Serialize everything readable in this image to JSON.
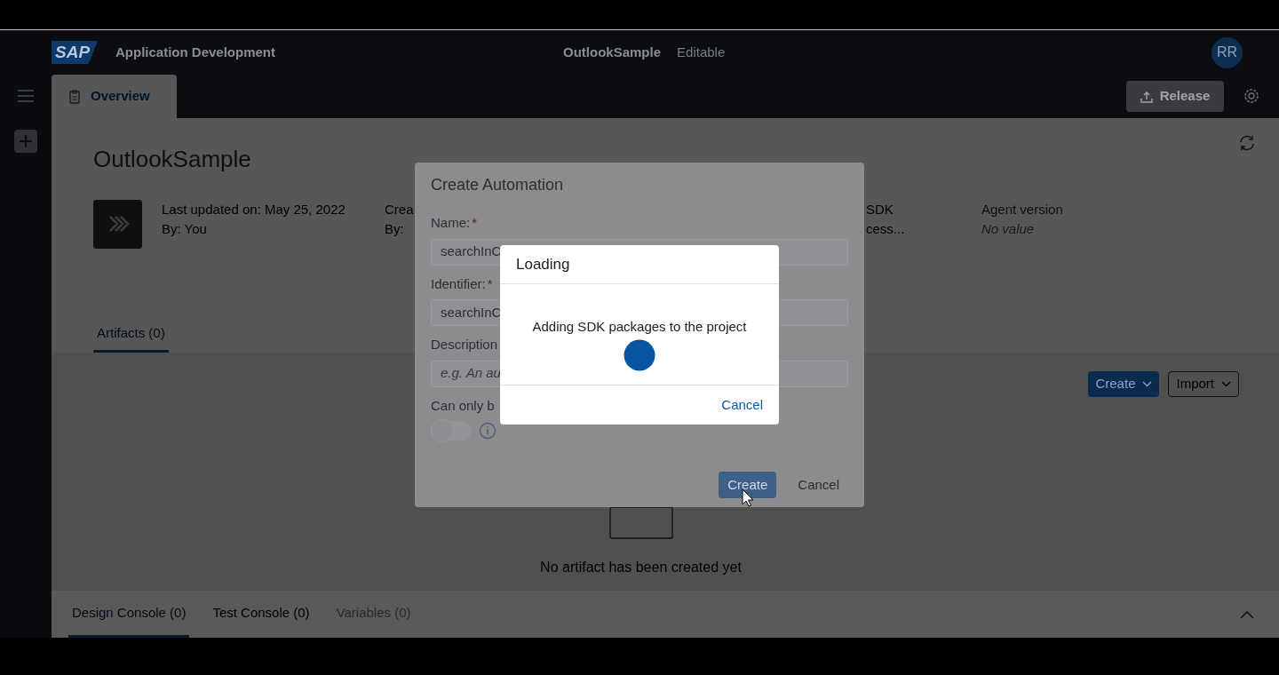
{
  "header": {
    "logo": "SAP",
    "app_title": "Application Development",
    "project_name": "OutlookSample",
    "project_state": "Editable",
    "avatar": "RR"
  },
  "tabs": [
    {
      "label": "Overview",
      "selected": true
    }
  ],
  "release_button": "Release",
  "page": {
    "title": "OutlookSample",
    "meta_columns": [
      {
        "lines": [
          {
            "text": "Last updated on: May 25, 2022",
            "kind": "value"
          },
          {
            "text": "By: You",
            "kind": "value"
          }
        ]
      },
      {
        "lines": [
          {
            "text": "Crea",
            "kind": "value"
          },
          {
            "text": "By:",
            "kind": "value"
          }
        ]
      },
      {
        "lines": [
          {
            "text": "SDK",
            "kind": "value"
          },
          {
            "text": "cess...",
            "kind": "value"
          }
        ]
      },
      {
        "lines": [
          {
            "text": "Agent version",
            "kind": "label"
          },
          {
            "text": "No value",
            "kind": "empty"
          }
        ]
      }
    ]
  },
  "section_tabs": [
    {
      "label": "Artifacts (0)",
      "selected": true
    }
  ],
  "artifact_buttons": [
    {
      "label": "Create",
      "kind": "primary"
    },
    {
      "label": "Import",
      "kind": "secondary"
    }
  ],
  "empty_state": "No artifact has been created yet",
  "console_tabs": [
    {
      "label": "Design Console (0)",
      "selected": true,
      "disabled": false
    },
    {
      "label": "Test Console (0)",
      "selected": false,
      "disabled": false
    },
    {
      "label": "Variables (0)",
      "selected": false,
      "disabled": true
    }
  ],
  "create_dialog": {
    "title": "Create Automation",
    "fields": [
      {
        "label": "Name:",
        "required_mark": "*",
        "value": "searchInC"
      },
      {
        "label": "Identifier:",
        "required_mark": "*",
        "value": "searchInC"
      },
      {
        "label": "Description",
        "placeholder": "e.g. An au"
      }
    ],
    "toggle": {
      "label": "Can only b",
      "on": false
    },
    "buttons": [
      {
        "label": "Create",
        "kind": "primary"
      },
      {
        "label": "Cancel",
        "kind": "secondary"
      }
    ]
  },
  "loading_dialog": {
    "title": "Loading",
    "message": "Adding SDK packages to the project",
    "cancel": "Cancel"
  }
}
